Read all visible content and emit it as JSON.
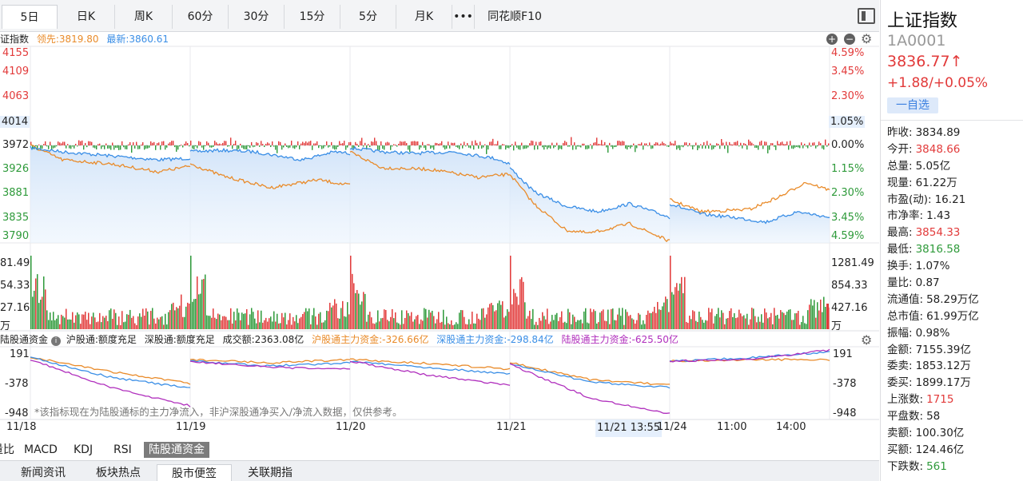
{
  "tabs": [
    {
      "label": "5日",
      "active": true
    },
    {
      "label": "日K"
    },
    {
      "label": "周K"
    },
    {
      "label": "60分"
    },
    {
      "label": "30分"
    },
    {
      "label": "15分"
    },
    {
      "label": "5分"
    },
    {
      "label": "月K"
    },
    {
      "label": "•••"
    },
    {
      "label": "同花顺F10"
    }
  ],
  "price_header": {
    "title": "证指数",
    "leader_label": "领先:3819.80",
    "latest_label": "最新:3860.61"
  },
  "price_axis_left": [
    "4155",
    "4109",
    "4063",
    "4014",
    "3972",
    "3926",
    "3881",
    "3835",
    "3790"
  ],
  "price_axis_right": [
    "4.59%",
    "3.45%",
    "2.30%",
    "1.05%",
    "0.00%",
    "1.15%",
    "2.30%",
    "3.45%",
    "4.59%"
  ],
  "volume_axis_left": [
    "81.49",
    "54.33",
    "27.16",
    "万"
  ],
  "volume_axis_right": [
    "1281.49",
    "854.33",
    "427.16",
    "万"
  ],
  "capital_header": {
    "title": "陆股通资金",
    "sh_quota": "沪股通:额度充足",
    "sz_quota": "深股通:额度充足",
    "turnover": "成交额:2363.08亿",
    "sh_flow": "沪股通主力资金:-326.66亿",
    "sz_flow": "深股通主力资金:-298.84亿",
    "total_flow": "陆股通主力资金:-625.50亿"
  },
  "capital_axis_left": [
    "191",
    "-378",
    "-948"
  ],
  "capital_axis_right": [
    "191",
    "-378",
    "-948"
  ],
  "capital_note": "*该指标现在为陆股通标的主力净流入，非沪深股通净买入/净流入数据，仅供参考。",
  "date_labels": [
    "11/18",
    "11/19",
    "11/20",
    "11/21",
    "11/21 13:55",
    "11/24",
    "11:00",
    "14:00"
  ],
  "indicator_tabs": [
    "量比",
    "MACD",
    "KDJ",
    "RSI",
    "陆股通资金"
  ],
  "news_tabs": [
    "新闻资讯",
    "板块热点",
    "股市便签",
    "关联期指"
  ],
  "colors": {
    "up": "#e23a3a",
    "down": "#2e9a3a",
    "orange": "#e98b2a",
    "blue": "#3a8ee6",
    "purple": "#b02fbd"
  },
  "side": {
    "name": "上证指数",
    "code": "1A0001",
    "price": "3836.77↑",
    "change": "+1.88/+0.05%",
    "fav_label": "一自选",
    "stats": [
      {
        "label": "昨收:",
        "value": "3834.89",
        "tone": ""
      },
      {
        "label": "今开:",
        "value": "3848.66",
        "tone": "red"
      },
      {
        "label": "总量:",
        "value": "5.05亿",
        "tone": ""
      },
      {
        "label": "现量:",
        "value": "61.22万",
        "tone": ""
      },
      {
        "label": "市盈(动):",
        "value": "16.21",
        "tone": ""
      },
      {
        "label": "市净率:",
        "value": "1.43",
        "tone": ""
      },
      {
        "label": "最高:",
        "value": "3854.33",
        "tone": "red"
      },
      {
        "label": "最低:",
        "value": "3816.58",
        "tone": "green"
      },
      {
        "label": "换手:",
        "value": "1.07%",
        "tone": ""
      },
      {
        "label": "量比:",
        "value": "0.87",
        "tone": ""
      },
      {
        "label": "流通值:",
        "value": "58.29万亿",
        "tone": ""
      },
      {
        "label": "总市值:",
        "value": "61.99万亿",
        "tone": ""
      },
      {
        "label": "振幅:",
        "value": "0.98%",
        "tone": ""
      },
      {
        "label": "金额:",
        "value": "7155.39亿",
        "tone": ""
      },
      {
        "label": "委卖:",
        "value": "1853.12万",
        "tone": ""
      },
      {
        "label": "委买:",
        "value": "1899.17万",
        "tone": ""
      },
      {
        "label": "上涨数:",
        "value": "1715",
        "tone": "red"
      },
      {
        "label": "平盘数:",
        "value": "58",
        "tone": ""
      },
      {
        "label": "卖额:",
        "value": "100.30亿",
        "tone": ""
      },
      {
        "label": "买额:",
        "value": "124.46亿",
        "tone": ""
      },
      {
        "label": "下跌数:",
        "value": "561",
        "tone": "green"
      }
    ]
  }
}
